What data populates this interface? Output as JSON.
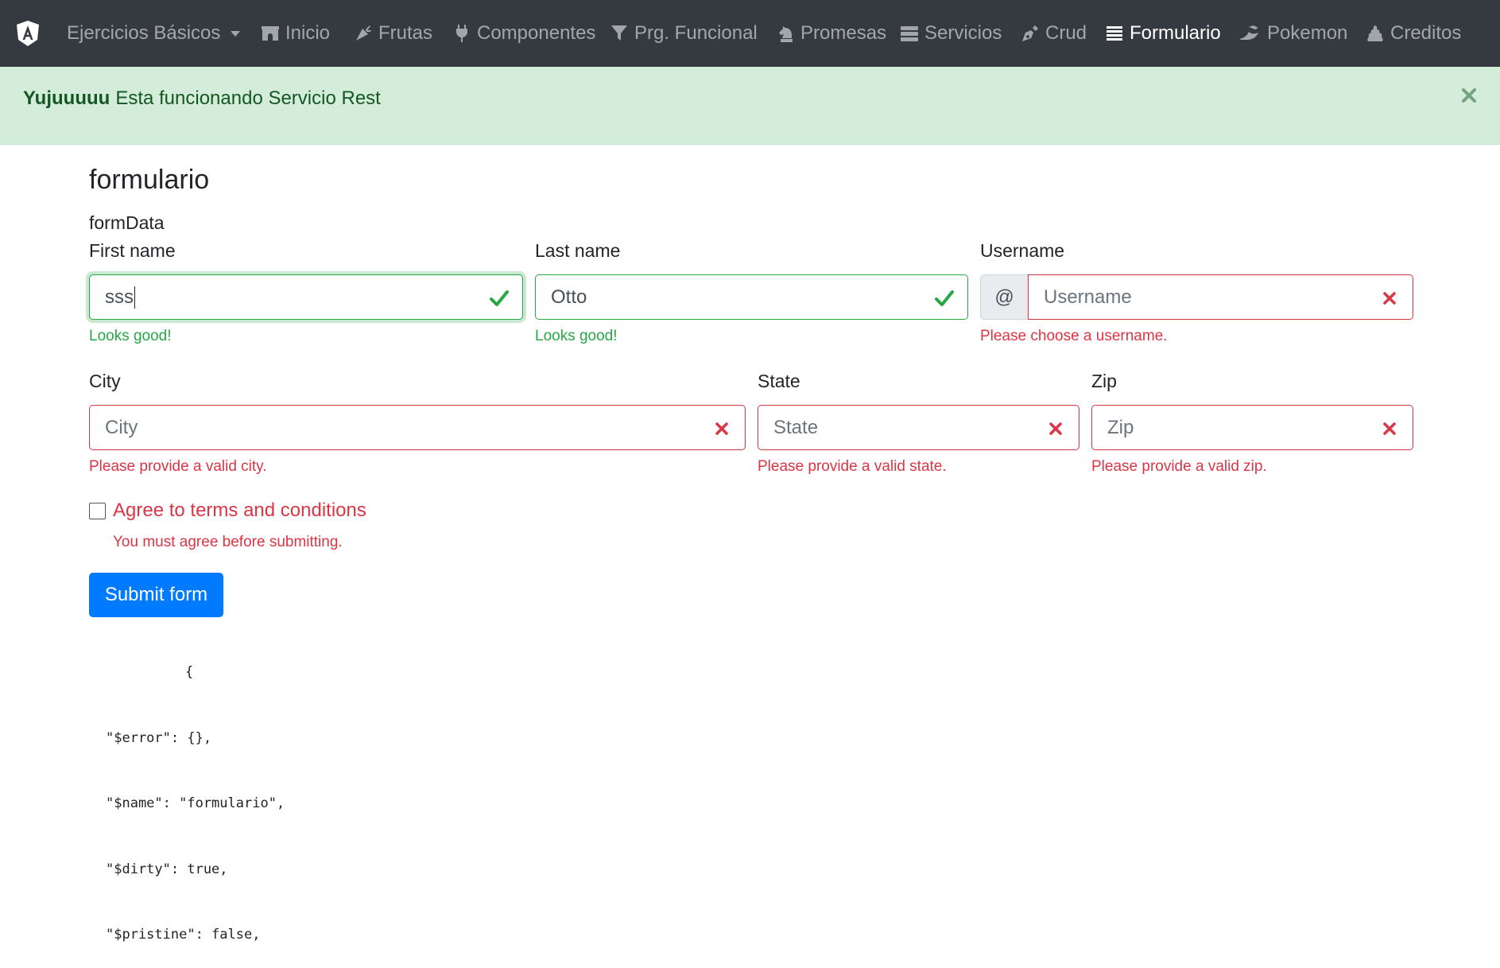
{
  "navbar": {
    "brand_icon": "angular-logo-icon",
    "items": [
      {
        "label": "Ejercicios Básicos",
        "icon": "none",
        "has_caret": true,
        "active": false
      },
      {
        "label": "Inicio",
        "icon": "archway-icon",
        "active": false
      },
      {
        "label": "Frutas",
        "icon": "carrot-icon",
        "active": false
      },
      {
        "label": "Componentes",
        "icon": "plug-icon",
        "active": false
      },
      {
        "label": "Prg. Funcional",
        "icon": "filter-icon",
        "active": false
      },
      {
        "label": "Promesas",
        "icon": "chess-knight-icon",
        "active": false
      },
      {
        "label": "Servicios",
        "icon": "server-icon",
        "active": false
      },
      {
        "label": "Crud",
        "icon": "pen-nib-icon",
        "active": false
      },
      {
        "label": "Formulario",
        "icon": "list-icon",
        "active": true
      },
      {
        "label": "Pokemon",
        "icon": "dragon-icon",
        "active": false
      },
      {
        "label": "Creditos",
        "icon": "poop-icon",
        "active": false
      }
    ]
  },
  "alert": {
    "strong": "Yujuuuuu",
    "message": "Esta funcionando Servicio Rest",
    "close_icon": "close-icon"
  },
  "main": {
    "title": "formulario",
    "form_name": "formData",
    "first_name": {
      "label": "First name",
      "value": "sss",
      "feedback": "Looks good!",
      "state": "valid"
    },
    "last_name": {
      "label": "Last name",
      "value": "Otto",
      "feedback": "Looks good!",
      "state": "valid"
    },
    "username": {
      "label": "Username",
      "addon": "@",
      "placeholder": "Username",
      "value": "",
      "feedback": "Please choose a username.",
      "state": "invalid"
    },
    "city": {
      "label": "City",
      "placeholder": "City",
      "value": "",
      "feedback": "Please provide a valid city.",
      "state": "invalid"
    },
    "state": {
      "label": "State",
      "placeholder": "State",
      "value": "",
      "feedback": "Please provide a valid state.",
      "state": "invalid"
    },
    "zip": {
      "label": "Zip",
      "placeholder": "Zip",
      "value": "",
      "feedback": "Please provide a valid zip.",
      "state": "invalid"
    },
    "terms": {
      "label": "Agree to terms and conditions",
      "checked": false,
      "feedback": "You must agree before submitting."
    },
    "submit_label": "Submit form",
    "json_dump": [
      "{",
      "\"$error\": {},",
      "\"$name\": \"formulario\",",
      "\"$dirty\": true,",
      "\"$pristine\": false,"
    ]
  },
  "colors": {
    "navbar_bg": "#343a40",
    "alert_bg": "#d4edda",
    "alert_text": "#155724",
    "valid": "#28a745",
    "invalid": "#dc3545",
    "primary": "#007bff"
  }
}
